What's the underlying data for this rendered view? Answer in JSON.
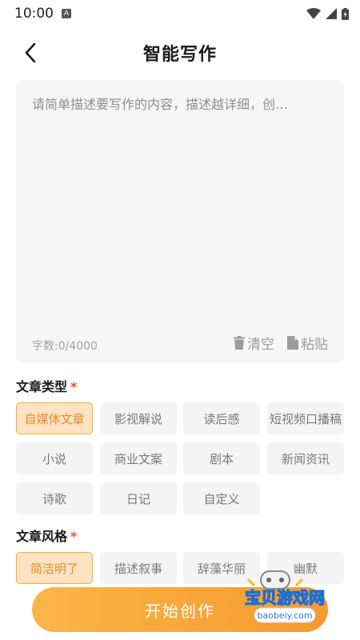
{
  "status": {
    "time": "10:00",
    "badge": "A"
  },
  "header": {
    "title": "智能写作"
  },
  "editor": {
    "placeholder": "请简单描述要写作的内容，描述越详细，创…",
    "counter": "字数:0/4000",
    "clear_label": "清空",
    "paste_label": "粘贴"
  },
  "article_type": {
    "label": "文章类型",
    "required_mark": "*",
    "options": [
      "自媒体文章",
      "影视解说",
      "读后感",
      "短视频口播稿",
      "小说",
      "商业文案",
      "剧本",
      "新闻资讯",
      "诗歌",
      "日记",
      "自定义"
    ],
    "selected": "自媒体文章"
  },
  "article_style": {
    "label": "文章风格",
    "required_mark": "*",
    "options": [
      "简洁明了",
      "描述叙事",
      "辞藻华丽",
      "幽默"
    ],
    "selected": "简洁明了"
  },
  "actions": {
    "start_label": "开始创作"
  },
  "watermark": {
    "text": "宝贝游戏网",
    "url_text": "baobeiy.com"
  },
  "colors": {
    "accent": "#f5a93e",
    "accent_bg": "#ffe3c2",
    "required": "#e84b3c"
  }
}
